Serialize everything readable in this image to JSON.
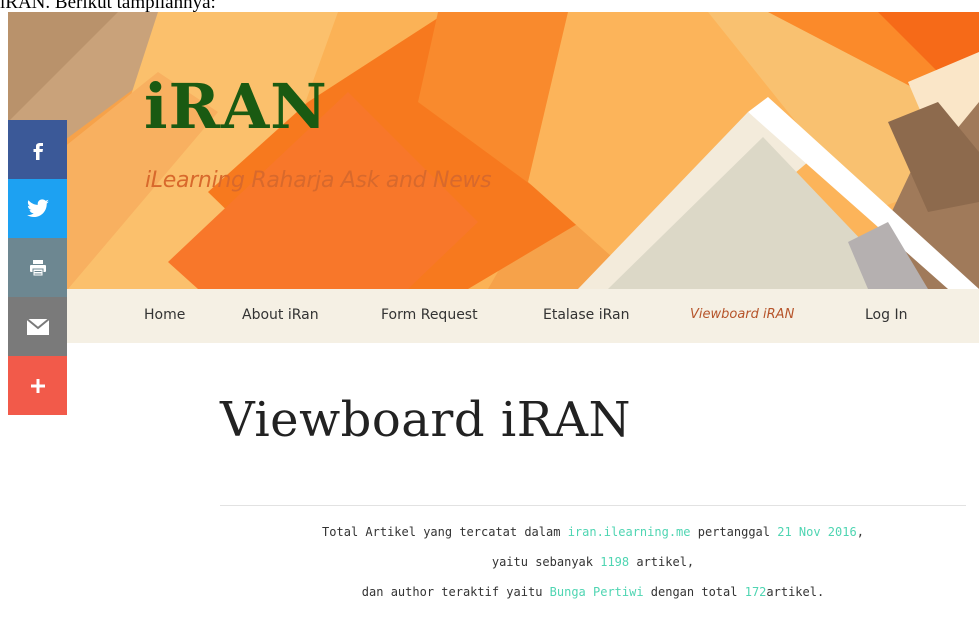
{
  "caption": "iRAN. Berikut tampilannya:",
  "site": {
    "title": "iRAN",
    "tagline": "iLearning Raharja Ask and News"
  },
  "nav": {
    "items": [
      {
        "label": "Home"
      },
      {
        "label": "About iRan"
      },
      {
        "label": "Form Request"
      },
      {
        "label": "Etalase iRan"
      },
      {
        "label": "Viewboard iRAN"
      },
      {
        "label": "Log In"
      }
    ],
    "active": "Viewboard iRAN"
  },
  "share": [
    {
      "icon": "facebook-icon",
      "color": "#3b5998"
    },
    {
      "icon": "twitter-icon",
      "color": "#1da1f2"
    },
    {
      "icon": "print-icon",
      "color": "#6d8791"
    },
    {
      "icon": "email-icon",
      "color": "#7a7a7a"
    },
    {
      "icon": "plus-icon",
      "color": "#f25a4a"
    }
  ],
  "page": {
    "title": "Viewboard iRAN"
  },
  "stats": {
    "line1_prefix": "Total Artikel yang tercatat dalam ",
    "site_link": "iran.ilearning.me",
    "line1_mid": " pertanggal ",
    "date": "21 Nov 2016",
    "line1_suffix": ",",
    "line2_prefix": "yaitu sebanyak ",
    "article_count": "1198",
    "line2_suffix": " artikel,",
    "line3_prefix": "dan author teraktif yaitu ",
    "top_author": "Bunga Pertiwi",
    "line3_mid": " dengan total ",
    "author_count": "172",
    "line3_suffix": "artikel."
  },
  "colors": {
    "title_green": "#1a5a12",
    "tagline_orange": "#d8692c",
    "highlight": "#4fd5b2",
    "nav_bg": "#f5f0e4"
  }
}
